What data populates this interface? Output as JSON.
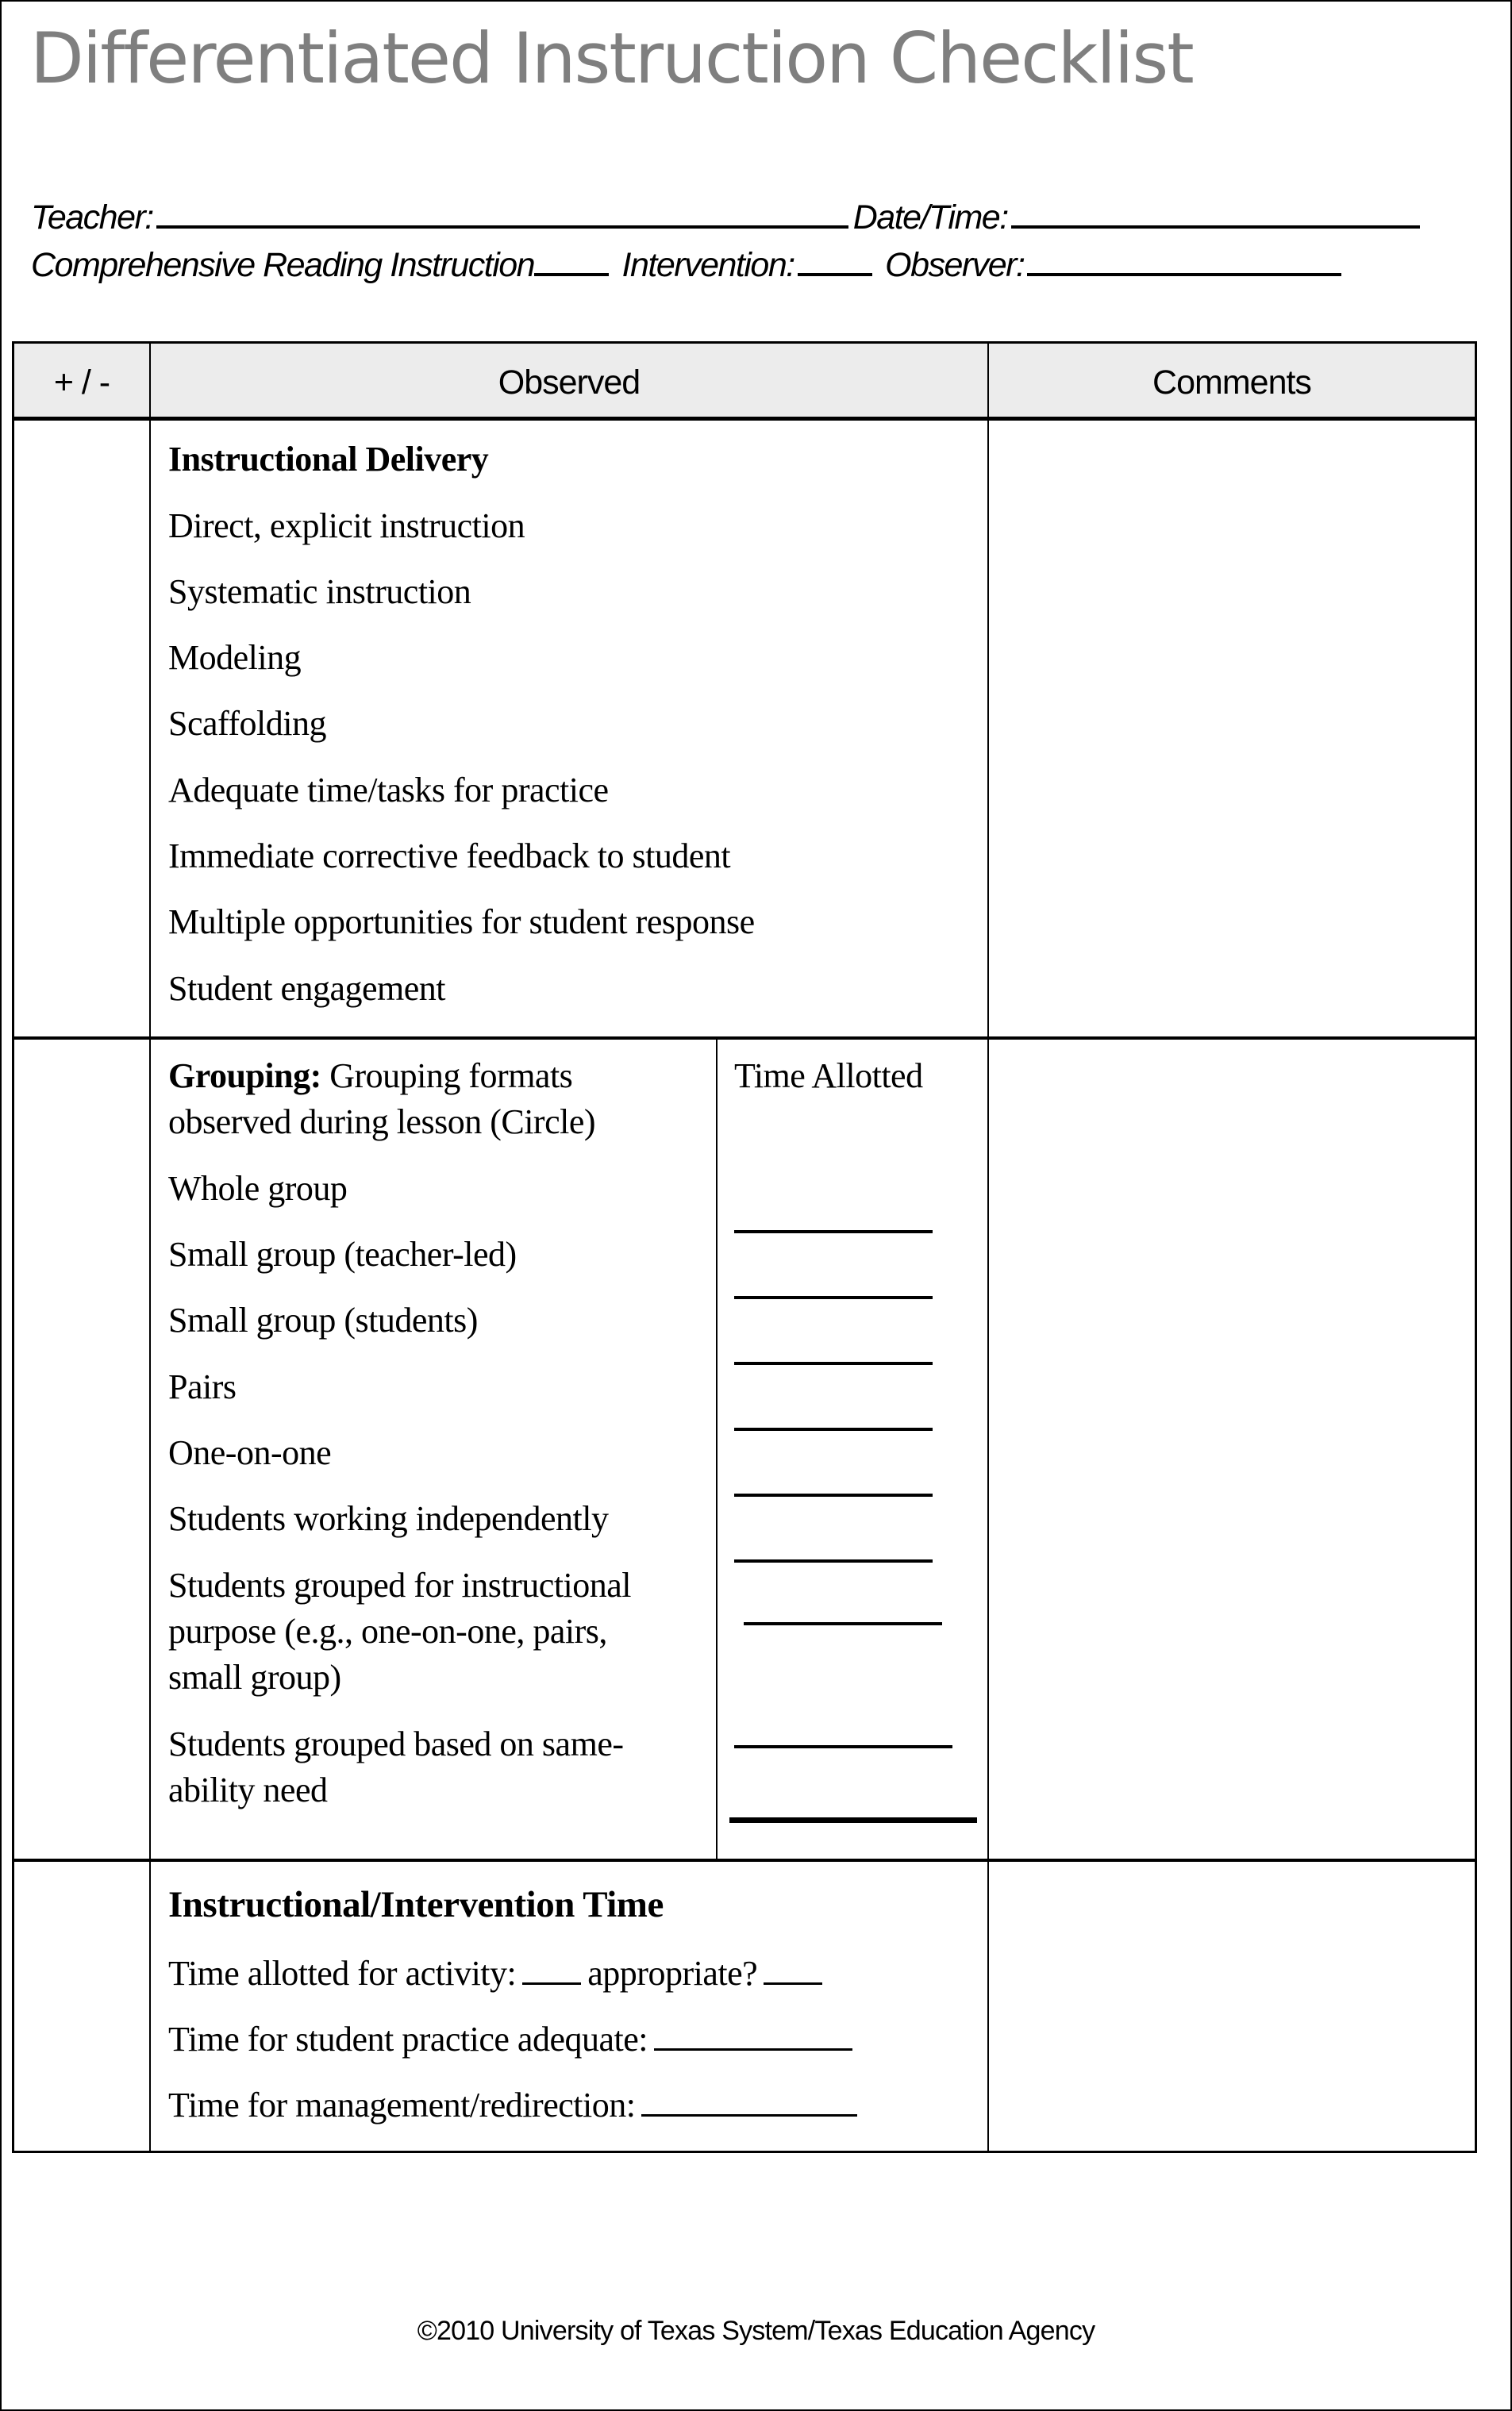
{
  "title": "Differentiated Instruction Checklist",
  "header_fields": {
    "teacher_label": "Teacher:",
    "teacher_value": "",
    "datetime_label": "Date/Time:",
    "datetime_value": "",
    "cri_label": "Comprehensive Reading Instruction",
    "cri_value": "",
    "intervention_label": "Intervention:",
    "intervention_value": "",
    "observer_label": "Observer:",
    "observer_value": ""
  },
  "table": {
    "columns": [
      "+ / -",
      "Observed",
      "Comments"
    ],
    "sections": [
      {
        "heading": "Instructional Delivery",
        "items": [
          "Direct, explicit instruction",
          "Systematic instruction",
          "Modeling",
          "Scaffolding",
          "Adequate time/tasks for practice",
          "Immediate corrective feedback to student",
          "Multiple opportunities for student response",
          "Student engagement"
        ]
      },
      {
        "heading": "Grouping:",
        "heading_rest_line1": " Grouping formats",
        "heading_rest_line2": "observed during lesson (Circle)",
        "time_allotted_label": "Time Allotted",
        "items": [
          "Whole group",
          "Small group (teacher-led)",
          "Small group (students)",
          "Pairs",
          "One-on-one",
          "Students working independently",
          "Students grouped for instructional",
          "purpose (e.g., one-on-one, pairs,",
          "small group)",
          "Students grouped based on same-",
          "ability need"
        ]
      },
      {
        "heading": "Instructional/Intervention Time",
        "items": [
          "Time allotted for activity:",
          "appropriate?",
          "Time for student practice adequate:",
          "Time for management/redirection:"
        ]
      }
    ]
  },
  "footer": "©2010 University of Texas System/Texas Education Agency"
}
